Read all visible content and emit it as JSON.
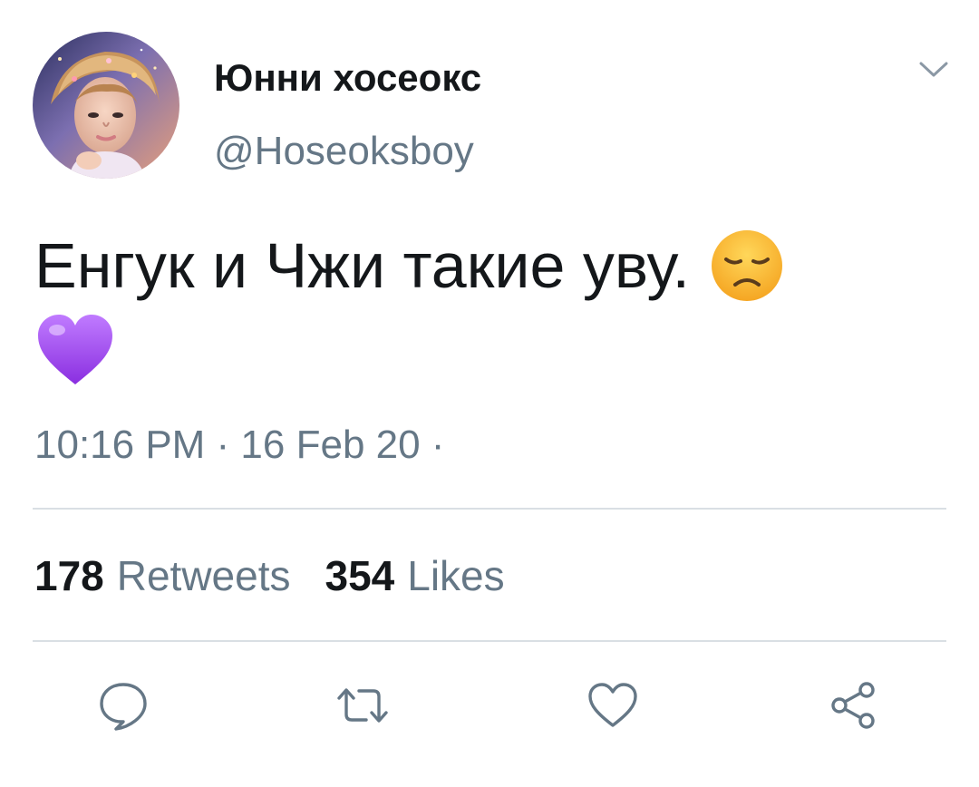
{
  "tweet": {
    "author": {
      "display_name": "Юнни хосеокс",
      "handle": "@Hoseoksboy",
      "avatar": "avatar-photo"
    },
    "text": "Енгук и Чжи такие уву.",
    "emojis": [
      "disappointed-face-emoji",
      "purple-heart-emoji"
    ],
    "timestamp": "10:16 PM · 16 Feb 20 ·",
    "stats": {
      "retweets_count": "178",
      "retweets_label": "Retweets",
      "likes_count": "354",
      "likes_label": "Likes"
    },
    "actions": [
      "reply-icon",
      "retweet-icon",
      "like-icon",
      "share-icon"
    ]
  },
  "colors": {
    "text_primary": "#14171a",
    "text_secondary": "#657786",
    "divider": "#d9dfe4",
    "emoji_yellow": "#ffc83a",
    "heart_purple": "#a24df0"
  }
}
